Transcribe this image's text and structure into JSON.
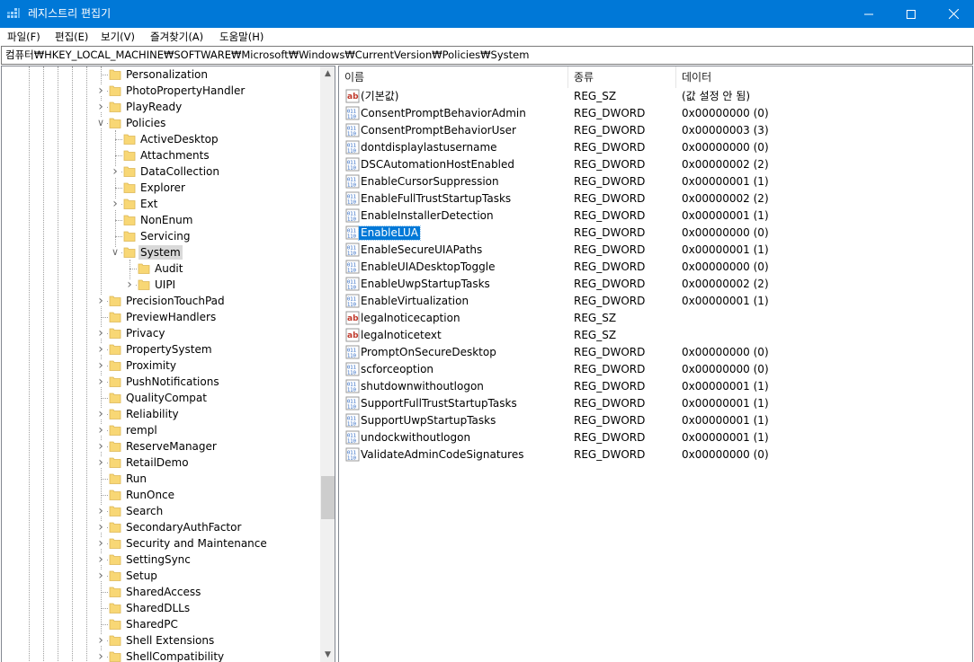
{
  "window": {
    "title": "레지스트리 편집기",
    "controls": {
      "minimize": "minimize",
      "maximize": "maximize",
      "close": "close"
    }
  },
  "menu": [
    "파일(F)",
    "편집(E)",
    "보기(V)",
    "즐겨찾기(A)",
    "도움말(H)"
  ],
  "address": "컴퓨터₩HKEY_LOCAL_MACHINE₩SOFTWARE₩Microsoft₩Windows₩CurrentVersion₩Policies₩System",
  "tree": [
    {
      "label": "Personalization",
      "level": 0,
      "exp": ""
    },
    {
      "label": "PhotoPropertyHandler",
      "level": 0,
      "exp": "collapsed"
    },
    {
      "label": "PlayReady",
      "level": 0,
      "exp": "collapsed"
    },
    {
      "label": "Policies",
      "level": 0,
      "exp": "expanded"
    },
    {
      "label": "ActiveDesktop",
      "level": 1,
      "exp": ""
    },
    {
      "label": "Attachments",
      "level": 1,
      "exp": ""
    },
    {
      "label": "DataCollection",
      "level": 1,
      "exp": "collapsed"
    },
    {
      "label": "Explorer",
      "level": 1,
      "exp": ""
    },
    {
      "label": "Ext",
      "level": 1,
      "exp": "collapsed"
    },
    {
      "label": "NonEnum",
      "level": 1,
      "exp": ""
    },
    {
      "label": "Servicing",
      "level": 1,
      "exp": ""
    },
    {
      "label": "System",
      "level": 1,
      "exp": "expanded",
      "selected": true
    },
    {
      "label": "Audit",
      "level": 2,
      "exp": ""
    },
    {
      "label": "UIPI",
      "level": 2,
      "exp": "collapsed"
    },
    {
      "label": "PrecisionTouchPad",
      "level": 0,
      "exp": "collapsed"
    },
    {
      "label": "PreviewHandlers",
      "level": 0,
      "exp": ""
    },
    {
      "label": "Privacy",
      "level": 0,
      "exp": "collapsed"
    },
    {
      "label": "PropertySystem",
      "level": 0,
      "exp": "collapsed"
    },
    {
      "label": "Proximity",
      "level": 0,
      "exp": "collapsed"
    },
    {
      "label": "PushNotifications",
      "level": 0,
      "exp": "collapsed"
    },
    {
      "label": "QualityCompat",
      "level": 0,
      "exp": ""
    },
    {
      "label": "Reliability",
      "level": 0,
      "exp": "collapsed"
    },
    {
      "label": "rempl",
      "level": 0,
      "exp": "collapsed"
    },
    {
      "label": "ReserveManager",
      "level": 0,
      "exp": "collapsed"
    },
    {
      "label": "RetailDemo",
      "level": 0,
      "exp": "collapsed"
    },
    {
      "label": "Run",
      "level": 0,
      "exp": ""
    },
    {
      "label": "RunOnce",
      "level": 0,
      "exp": ""
    },
    {
      "label": "Search",
      "level": 0,
      "exp": "collapsed"
    },
    {
      "label": "SecondaryAuthFactor",
      "level": 0,
      "exp": "collapsed"
    },
    {
      "label": "Security and Maintenance",
      "level": 0,
      "exp": "collapsed"
    },
    {
      "label": "SettingSync",
      "level": 0,
      "exp": "collapsed"
    },
    {
      "label": "Setup",
      "level": 0,
      "exp": "collapsed"
    },
    {
      "label": "SharedAccess",
      "level": 0,
      "exp": ""
    },
    {
      "label": "SharedDLLs",
      "level": 0,
      "exp": ""
    },
    {
      "label": "SharedPC",
      "level": 0,
      "exp": ""
    },
    {
      "label": "Shell Extensions",
      "level": 0,
      "exp": "collapsed"
    },
    {
      "label": "ShellCompatibility",
      "level": 0,
      "exp": "collapsed"
    }
  ],
  "list": {
    "columns": [
      "이름",
      "종류",
      "데이터"
    ],
    "rows": [
      {
        "name": "(기본값)",
        "type": "REG_SZ",
        "data": "(값 설정 안 됨)",
        "icon": "string-value-icon"
      },
      {
        "name": "ConsentPromptBehaviorAdmin",
        "type": "REG_DWORD",
        "data": "0x00000000 (0)",
        "icon": "binary-value-icon"
      },
      {
        "name": "ConsentPromptBehaviorUser",
        "type": "REG_DWORD",
        "data": "0x00000003 (3)",
        "icon": "binary-value-icon"
      },
      {
        "name": "dontdisplaylastusername",
        "type": "REG_DWORD",
        "data": "0x00000000 (0)",
        "icon": "binary-value-icon"
      },
      {
        "name": "DSCAutomationHostEnabled",
        "type": "REG_DWORD",
        "data": "0x00000002 (2)",
        "icon": "binary-value-icon"
      },
      {
        "name": "EnableCursorSuppression",
        "type": "REG_DWORD",
        "data": "0x00000001 (1)",
        "icon": "binary-value-icon"
      },
      {
        "name": "EnableFullTrustStartupTasks",
        "type": "REG_DWORD",
        "data": "0x00000002 (2)",
        "icon": "binary-value-icon"
      },
      {
        "name": "EnableInstallerDetection",
        "type": "REG_DWORD",
        "data": "0x00000001 (1)",
        "icon": "binary-value-icon"
      },
      {
        "name": "EnableLUA",
        "type": "REG_DWORD",
        "data": "0x00000000 (0)",
        "icon": "binary-value-icon",
        "selected": true
      },
      {
        "name": "EnableSecureUIAPaths",
        "type": "REG_DWORD",
        "data": "0x00000001 (1)",
        "icon": "binary-value-icon"
      },
      {
        "name": "EnableUIADesktopToggle",
        "type": "REG_DWORD",
        "data": "0x00000000 (0)",
        "icon": "binary-value-icon"
      },
      {
        "name": "EnableUwpStartupTasks",
        "type": "REG_DWORD",
        "data": "0x00000002 (2)",
        "icon": "binary-value-icon"
      },
      {
        "name": "EnableVirtualization",
        "type": "REG_DWORD",
        "data": "0x00000001 (1)",
        "icon": "binary-value-icon"
      },
      {
        "name": "legalnoticecaption",
        "type": "REG_SZ",
        "data": "",
        "icon": "string-value-icon"
      },
      {
        "name": "legalnoticetext",
        "type": "REG_SZ",
        "data": "",
        "icon": "string-value-icon"
      },
      {
        "name": "PromptOnSecureDesktop",
        "type": "REG_DWORD",
        "data": "0x00000000 (0)",
        "icon": "binary-value-icon"
      },
      {
        "name": "scforceoption",
        "type": "REG_DWORD",
        "data": "0x00000000 (0)",
        "icon": "binary-value-icon"
      },
      {
        "name": "shutdownwithoutlogon",
        "type": "REG_DWORD",
        "data": "0x00000001 (1)",
        "icon": "binary-value-icon"
      },
      {
        "name": "SupportFullTrustStartupTasks",
        "type": "REG_DWORD",
        "data": "0x00000001 (1)",
        "icon": "binary-value-icon"
      },
      {
        "name": "SupportUwpStartupTasks",
        "type": "REG_DWORD",
        "data": "0x00000001 (1)",
        "icon": "binary-value-icon"
      },
      {
        "name": "undockwithoutlogon",
        "type": "REG_DWORD",
        "data": "0x00000001 (1)",
        "icon": "binary-value-icon"
      },
      {
        "name": "ValidateAdminCodeSignatures",
        "type": "REG_DWORD",
        "data": "0x00000000 (0)",
        "icon": "binary-value-icon"
      }
    ]
  },
  "colors": {
    "titlebar": "#0078d7",
    "selection": "#0078d7",
    "tree_selection": "#d9d9d9",
    "folder": "#f8d775"
  }
}
